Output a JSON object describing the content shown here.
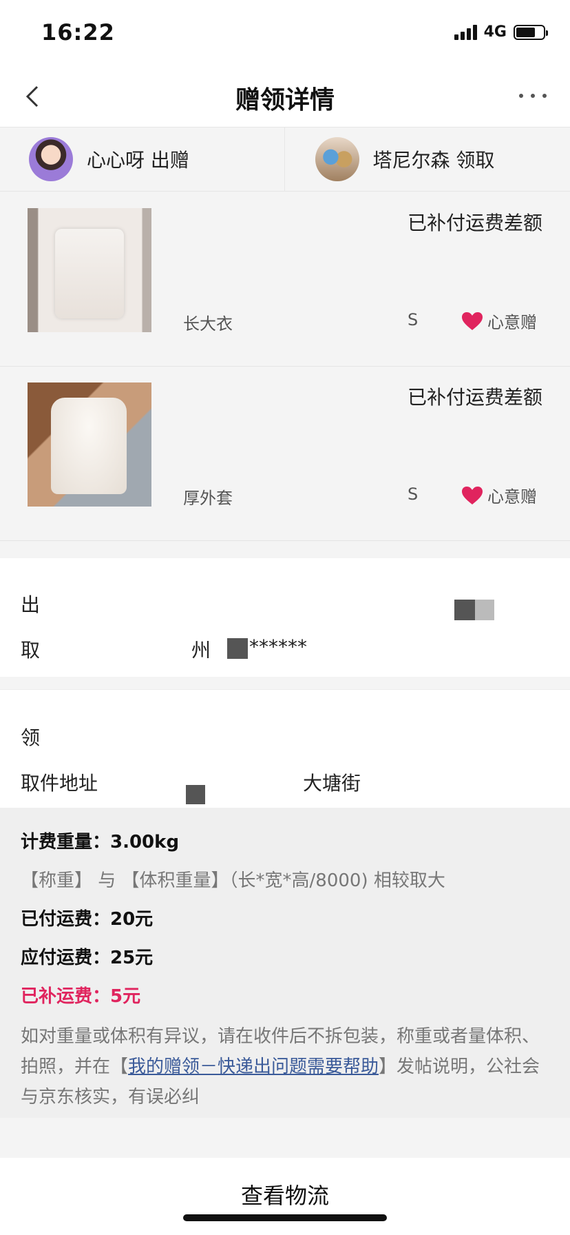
{
  "status_bar": {
    "time": "16:22",
    "network": "4G"
  },
  "nav": {
    "title": "赠领详情"
  },
  "users": {
    "giver": {
      "text": "心心呀 出赠"
    },
    "receiver": {
      "text": "塔尼尔森 领取"
    }
  },
  "items": [
    {
      "status": "已补付运费差额",
      "name": "长大衣",
      "size": "S",
      "gift_label": "心意赠"
    },
    {
      "status": "已补付运费差额",
      "name": "厚外套",
      "size": "S",
      "gift_label": "心意赠"
    }
  ],
  "sender_address": {
    "line1_label": "出",
    "line2_label": "取",
    "line2_fragment": "州",
    "line2_masked": "******"
  },
  "receiver_address": {
    "line1_label": "领",
    "line2_label": "取件地址",
    "line2_fragment": "大塘街"
  },
  "fee": {
    "weight": "计费重量：3.00kg",
    "weight_note": "【称重】 与 【体积重量】（长*宽*高/8000) 相较取大",
    "paid": "已付运费：20元",
    "due": "应付运费：25元",
    "supplement": "已补运费：5元",
    "desc_before": "如对重量或体积有异议，请在收件后不拆包装，称重或者量体积、拍照，并在【",
    "desc_link": "我的赠领－快递出问题需要帮助",
    "desc_after": "】发帖说明，公社会与京东核实，有误必纠"
  },
  "bottom": {
    "button": "查看物流"
  },
  "colors": {
    "accent_red": "#e0245e",
    "link_blue": "#3a5a99"
  },
  "icons": [
    "back-chevron-icon",
    "more-dots-icon",
    "heart-icon",
    "signal-icon",
    "battery-icon"
  ]
}
